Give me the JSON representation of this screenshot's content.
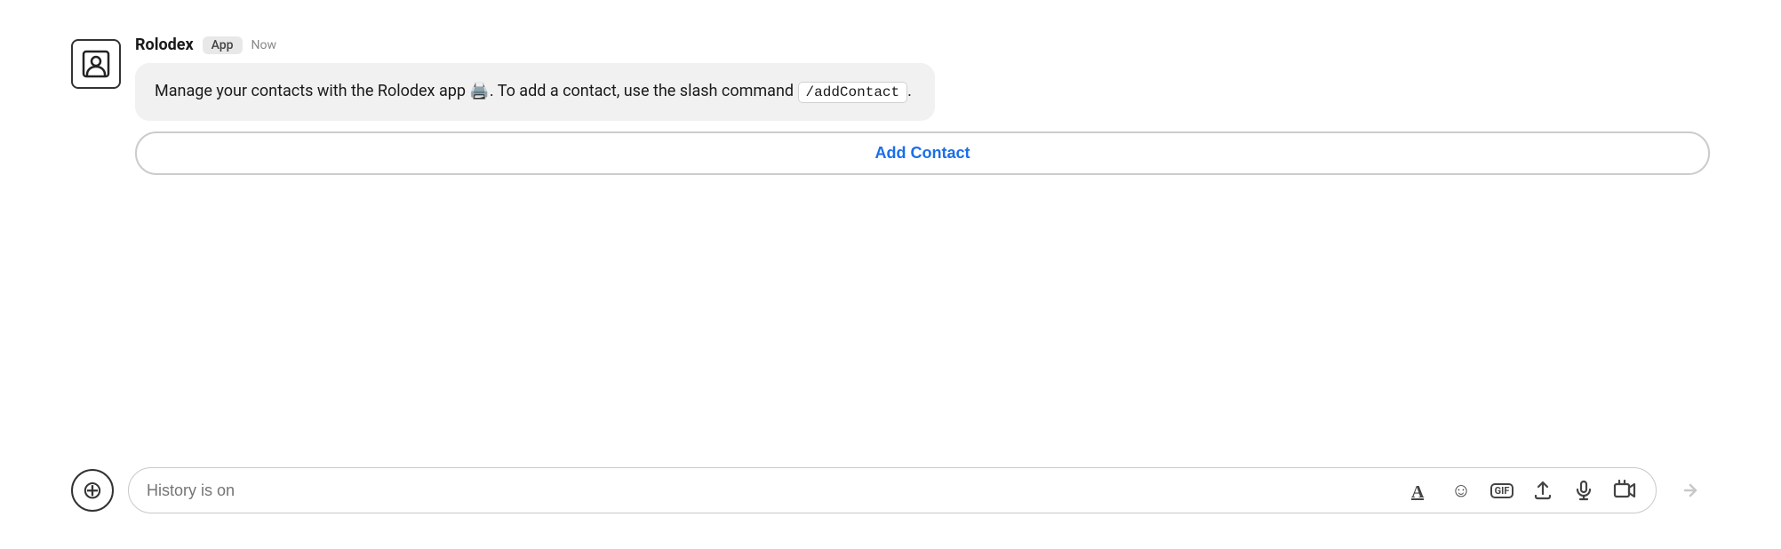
{
  "message": {
    "sender": "Rolodex",
    "badge": "App",
    "timestamp": "Now",
    "body_part1": "Manage your contacts with the Rolodex app ",
    "body_emoji": "🖨️",
    "body_part2": ". To add a contact, use the slash command ",
    "body_code": "/addContact",
    "body_part3": ".",
    "add_contact_label": "Add Contact"
  },
  "input": {
    "placeholder": "History is on",
    "add_icon": "+",
    "send_icon": "▷"
  },
  "toolbar": {
    "format_icon": "A",
    "emoji_icon": "☺",
    "gif_label": "GIF",
    "upload_icon": "↑",
    "mic_icon": "🎤",
    "video_icon": "⊞"
  }
}
